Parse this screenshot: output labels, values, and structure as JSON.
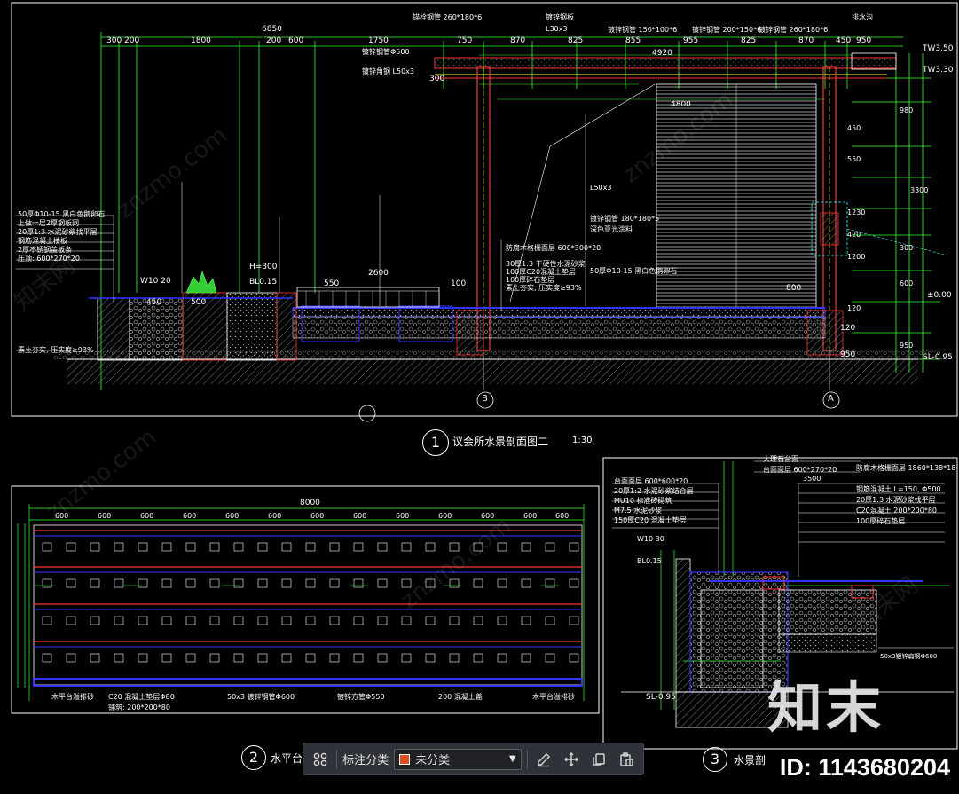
{
  "drawing": {
    "detail_1": {
      "number": "1",
      "title": "议会所水景剖面图二",
      "scale": "1:30"
    },
    "detail_2": {
      "number": "2",
      "title": "水平台材"
    },
    "detail_3": {
      "number": "3",
      "title": "水景剖"
    },
    "top_dimensions": [
      "300",
      "200",
      "1800",
      "200",
      "600",
      "1750",
      "750",
      "870",
      "825",
      "855",
      "955",
      "825",
      "870",
      "450",
      "950"
    ],
    "overall_dimension": "6850",
    "mid_dimension": "4920",
    "plan_dimension": "8000",
    "plan_dimensions": [
      "600",
      "600",
      "600",
      "600",
      "600",
      "600",
      "600",
      "600",
      "600",
      "600",
      "600",
      "600",
      "600"
    ],
    "elevations": [
      "TW3.50",
      "TW3.30",
      "±0.00",
      "SL-0.95",
      "SL-0.95"
    ],
    "grid_marks": [
      "B",
      "A"
    ],
    "side_dims": [
      "980",
      "450",
      "550",
      "3300",
      "1230",
      "420",
      "300",
      "1200",
      "600",
      "120",
      "950"
    ],
    "notes_left": [
      "50厚Φ10-15 黑白色鹅卵石",
      "上做一层2厚钢板网",
      "20厚1:3 水泥砂浆找平层",
      "钢筋混凝土楼板",
      "2厚不锈钢盖板条",
      "压顶: 600*270*20",
      "素土夯实, 压实度≥93%"
    ],
    "notes_top": [
      "锚栓钢管 260*180*6",
      "镀锌钢管Φ500",
      "镀锌角钢 L50x3",
      "镀锌钢板",
      "L30x3",
      "镀锌钢管 150*100*6",
      "镀锌钢管 200*150*6",
      "镀锌钢管 260*180*6",
      "排水沟"
    ],
    "notes_center": [
      "防腐木格栅面层 600*300*20",
      "30厚1:3 干硬性水泥砂浆",
      "100厚C20混凝土垫层",
      "100厚碎石垫层",
      "素土夯实, 压实度≥93%",
      "镀锌钢管 180*180*5",
      "深色亚光涂料",
      "L50x3",
      "50厚Φ10-15 黑白色鹅卵石"
    ],
    "notes_right_3": [
      "大理石台面",
      "台面面层 600*270*20",
      "防腐木格栅面层 1860*138*18",
      "钢筋混凝土 L=150, Φ500",
      "20厚1:3 水泥砂浆找平层",
      "C20混凝土 200*200*80",
      "100厚碎石垫层"
    ],
    "notes_left_3": [
      "台面面层 600*600*20",
      "20厚1:2 水泥砂浆结合层",
      "MU10 标准砖砌筑",
      "M7.5 水泥砂浆",
      "150厚C20 混凝土垫层",
      "W10 30",
      "BL0.15"
    ],
    "plan_bottom_notes": [
      "木平台溢排砂",
      "C20 混凝土垫层Φ80",
      "铺筑: 200*200*80",
      "50x3 镀锌钢管Φ600",
      "镀锌方管Φ550",
      "200 混凝土盖",
      "木平台溢排砂"
    ],
    "misc_labels": [
      "W10 20",
      "BL0.15",
      "H=300",
      "500",
      "450",
      "2600",
      "550",
      "100",
      "300",
      "4800",
      "800",
      "120",
      "950",
      "50x3镀锌扁钢Φ600",
      "3500"
    ]
  },
  "watermark": {
    "logo_text": "知末",
    "id_text": "ID: 1143680204",
    "faint_text": "znzmo.com",
    "faint_cn": "知末网"
  },
  "toolbar": {
    "grid_icon": "grid-icon",
    "category_label": "标注分类",
    "select_value": "未分类",
    "select_swatch_color": "#e0501e",
    "actions": [
      "edit-icon",
      "move-icon",
      "copy-icon",
      "paste-icon"
    ]
  },
  "colors": {
    "background": "#000000",
    "frame": "#ffffff",
    "dim_green": "#33ff33",
    "water_blue": "#2222ff",
    "pipe_red": "#ff2222",
    "accent_yellow": "#ffff33",
    "accent_cyan": "#33ffff",
    "toolbar_bg": "#2f3238"
  }
}
